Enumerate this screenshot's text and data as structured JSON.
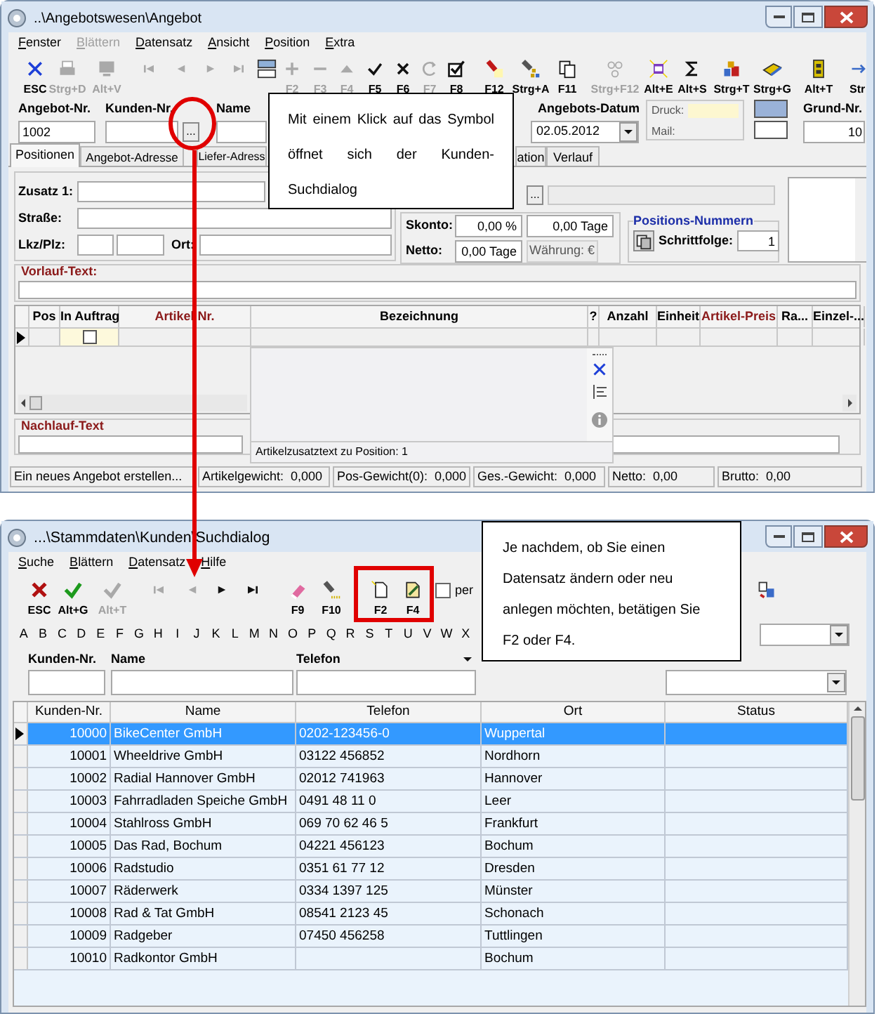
{
  "window": {
    "title": "..\\Angebotswesen\\Angebot"
  },
  "menu": [
    {
      "label": "Fenster",
      "disabled": false
    },
    {
      "label": "Blättern",
      "disabled": true
    },
    {
      "label": "Datensatz",
      "disabled": false
    },
    {
      "label": "Ansicht",
      "disabled": false
    },
    {
      "label": "Position",
      "disabled": false
    },
    {
      "label": "Extra",
      "disabled": false
    }
  ],
  "toolbar": [
    {
      "kind": "esc",
      "label": "ESC",
      "disabled": false
    },
    {
      "kind": "print",
      "label": "Strg+D",
      "disabled": true
    },
    {
      "kind": "monitor",
      "label": "Alt+V",
      "disabled": true
    },
    {
      "kind": "first",
      "disabled": true
    },
    {
      "kind": "prev",
      "disabled": true
    },
    {
      "kind": "next",
      "disabled": true
    },
    {
      "kind": "last",
      "disabled": true
    },
    {
      "kind": "layout",
      "disabled": false
    },
    {
      "kind": "plus",
      "label": "F2",
      "disabled": true
    },
    {
      "kind": "minus",
      "label": "F3",
      "disabled": true
    },
    {
      "kind": "up",
      "label": "F4",
      "disabled": true
    },
    {
      "kind": "check",
      "label": "F5",
      "disabled": false
    },
    {
      "kind": "cross",
      "label": "F6",
      "disabled": false
    },
    {
      "kind": "redo",
      "label": "F7",
      "disabled": true
    },
    {
      "kind": "checkbox",
      "label": "F8",
      "disabled": false
    },
    {
      "kind": "torch",
      "label": "F12",
      "disabled": false
    },
    {
      "kind": "torchnet",
      "label": "Strg+A",
      "disabled": false
    },
    {
      "kind": "copy",
      "label": "F11",
      "disabled": false
    },
    {
      "kind": "nodes",
      "label": "Strg+F12",
      "disabled": true
    },
    {
      "kind": "note",
      "label": "Alt+E",
      "disabled": false
    },
    {
      "kind": "sigma",
      "label": "Alt+S",
      "disabled": false
    },
    {
      "kind": "boxes",
      "label": "Strg+T",
      "disabled": false
    },
    {
      "kind": "book",
      "label": "Strg+G",
      "disabled": false
    },
    {
      "kind": "cube",
      "label": "Alt+T",
      "disabled": false
    },
    {
      "kind": "arrow",
      "label": "Str",
      "disabled": false
    }
  ],
  "header": {
    "offer_number": {
      "label": "Angebot-Nr.",
      "value": "1002"
    },
    "customer_number": {
      "label": "Kunden-Nr.",
      "button": "..."
    },
    "name": {
      "label": "Name"
    },
    "offer_date": {
      "label": "Angebots-Datum",
      "value": "02.05.2012"
    },
    "output": {
      "print_label": "Druck:",
      "mail_label": "Mail:"
    },
    "base_number": {
      "label": "Grund-Nr.",
      "value": "10"
    }
  },
  "tabs": [
    {
      "label": "Positionen",
      "selected": true
    },
    {
      "label": "Angebot-Adresse",
      "selected": false
    },
    {
      "label": "Liefer-Adress",
      "selected": false
    },
    {
      "label": "ation",
      "selected": false
    },
    {
      "label": "Verlauf",
      "selected": false
    }
  ],
  "address": {
    "zusatz_label": "Zusatz 1:",
    "street_label": "Straße:",
    "zip_label": "Lkz/Plz:",
    "city_label": "Ort:",
    "lookup_button": "..."
  },
  "terms": {
    "skonto_label": "Skonto:",
    "skonto_percent": "0,00 %",
    "skonto_days": "0,00 Tage",
    "netto_label": "Netto:",
    "netto_days": "0,00 Tage",
    "currency": "Währung: €"
  },
  "position_numbers": {
    "title": "Positions-Nummern",
    "step_label": "Schrittfolge:",
    "step": "1"
  },
  "preface": {
    "title": "Vorlauf-Text:"
  },
  "positions_table": {
    "columns": [
      {
        "label": "Pos",
        "color": "#000000"
      },
      {
        "label": "In Auftrag",
        "color": "#000000"
      },
      {
        "label": "Artikel Nr.",
        "color": "#8b1a1a"
      },
      {
        "label": "Bezeichnung",
        "color": "#000000"
      },
      {
        "label": "?",
        "color": "#000000"
      },
      {
        "label": "Anzahl",
        "color": "#000000"
      },
      {
        "label": "Einheit",
        "color": "#000000"
      },
      {
        "label": "Artikel-Preis",
        "color": "#8b1a1a"
      },
      {
        "label": "Ra...",
        "color": "#000000"
      },
      {
        "label": "Einzel-...",
        "color": "#000000"
      }
    ],
    "rows": [
      {
        "current": true,
        "in_auftrag": false
      }
    ]
  },
  "item_text_panel": {
    "caption": "Artikelzusatztext zu Position: 1"
  },
  "epilogue": {
    "title": "Nachlauf-Text"
  },
  "status_bar": [
    "Ein neues Angebot erstellen...",
    "Artikelgewicht:  0,000",
    "Pos-Gewicht(0):  0,000",
    "Ges.-Gewicht:  0,000",
    "Netto:  0,00",
    "Brutto:  0,00"
  ],
  "callout_1": {
    "text": "Mit einem Klick auf das Symbol öffnet sich der Kunden-Suchdialog"
  },
  "search_window": {
    "title": "...\\Stammdaten\\Kunden\\Suchdialog",
    "menu": [
      {
        "label": "Suche",
        "disabled": false
      },
      {
        "label": "Blättern",
        "disabled": false
      },
      {
        "label": "Datensatz",
        "disabled": false
      },
      {
        "label": "Hilfe",
        "disabled": false
      }
    ],
    "toolbar": [
      {
        "kind": "esc_red",
        "label": "ESC",
        "disabled": false
      },
      {
        "kind": "check_green",
        "label": "Alt+G",
        "disabled": false
      },
      {
        "kind": "check_green",
        "label": "Alt+T",
        "disabled": true
      },
      {
        "kind": "first",
        "disabled": true
      },
      {
        "kind": "prev",
        "disabled": true
      },
      {
        "kind": "next",
        "disabled": false
      },
      {
        "kind": "last",
        "disabled": false
      },
      {
        "kind": "eraser",
        "label": "F9",
        "disabled": false
      },
      {
        "kind": "torch2",
        "label": "F10",
        "disabled": false
      },
      {
        "kind": "newdoc",
        "label": "F2",
        "disabled": false
      },
      {
        "kind": "editdoc",
        "label": "F4",
        "disabled": false
      }
    ],
    "perm_checkbox": {
      "label": "per",
      "checked": false
    },
    "tools_right": [
      {
        "kind": "swap",
        "disabled": false
      }
    ],
    "letters": [
      "A",
      "B",
      "C",
      "D",
      "E",
      "F",
      "G",
      "H",
      "I",
      "J",
      "K",
      "L",
      "M",
      "N",
      "O",
      "P",
      "Q",
      "R",
      "S",
      "T",
      "U",
      "V",
      "W",
      "X"
    ],
    "filter_columns": [
      "Kunden-Nr.",
      "Name",
      "Telefon"
    ],
    "grid": {
      "columns": [
        "Kunden-Nr.",
        "Name",
        "Telefon",
        "Ort",
        "Status"
      ],
      "rows": [
        {
          "number": "10000",
          "name": "BikeCenter GmbH",
          "phone": "0202-123456-0",
          "city": "Wuppertal",
          "selected": true
        },
        {
          "number": "10001",
          "name": "Wheeldrive GmbH",
          "phone": "03122 456852",
          "city": "Nordhorn",
          "selected": false
        },
        {
          "number": "10002",
          "name": "Radial Hannover GmbH",
          "phone": "02012 741963",
          "city": "Hannover",
          "selected": false
        },
        {
          "number": "10003",
          "name": "Fahrradladen Speiche GmbH",
          "phone": "0491 48 11 0",
          "city": "Leer",
          "selected": false
        },
        {
          "number": "10004",
          "name": "Stahlross GmbH",
          "phone": "069 70 62 46 5",
          "city": "Frankfurt",
          "selected": false
        },
        {
          "number": "10005",
          "name": "Das Rad, Bochum",
          "phone": "04221 456123",
          "city": "Bochum",
          "selected": false
        },
        {
          "number": "10006",
          "name": "Radstudio",
          "phone": "0351 61 77 12",
          "city": "Dresden",
          "selected": false
        },
        {
          "number": "10007",
          "name": "Räderwerk",
          "phone": "0334 1397 125",
          "city": "Münster",
          "selected": false
        },
        {
          "number": "10008",
          "name": "Rad & Tat GmbH",
          "phone": "08541 2123 45",
          "city": "Schonach",
          "selected": false
        },
        {
          "number": "10009",
          "name": "Radgeber",
          "phone": "07450 456258",
          "city": "Tuttlingen",
          "selected": false
        },
        {
          "number": "10010",
          "name": "Radkontor GmbH",
          "city": "Bochum",
          "selected": false
        }
      ]
    }
  },
  "callout_2": {
    "text": "Je nachdem, ob Sie einen Datensatz ändern oder neu anlegen möchten, betätigen Sie F2 oder F4."
  }
}
